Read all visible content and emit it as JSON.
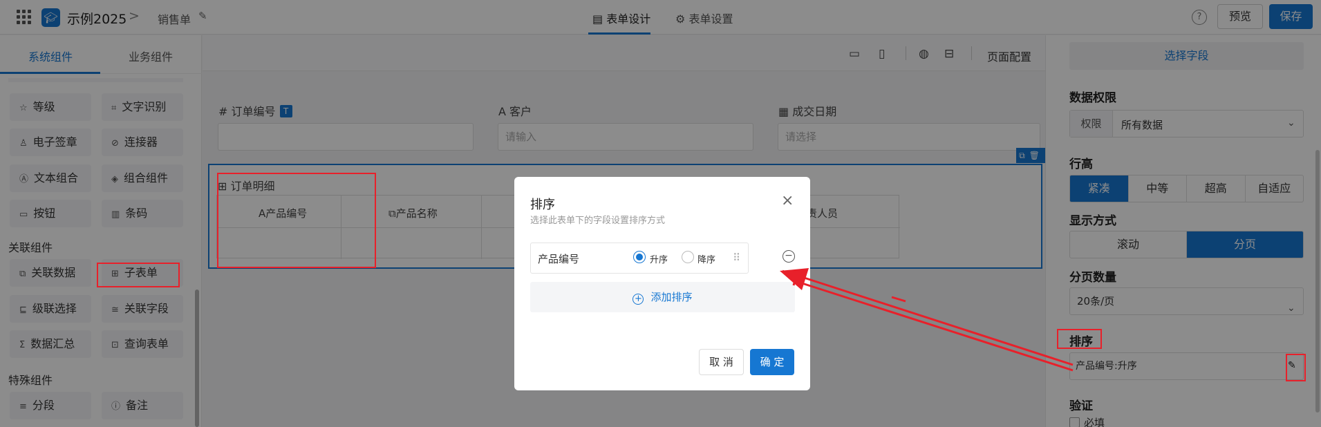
{
  "topbar": {
    "app_name": "示例2025",
    "separator": ">",
    "form_name": "销售单",
    "tabs": [
      {
        "label": "表单设计",
        "icon": "document-icon"
      },
      {
        "label": "表单设置",
        "icon": "gear-icon"
      }
    ],
    "help": "?",
    "preview_label": "预览",
    "save_label": "保存"
  },
  "left_panel": {
    "tabs": [
      "系统组件",
      "业务组件"
    ],
    "components_top": [
      {
        "label": "等级",
        "icon": "☆"
      },
      {
        "label": "文字识别",
        "icon": "⌗"
      },
      {
        "label": "电子签章",
        "icon": "♙"
      },
      {
        "label": "连接器",
        "icon": "⊘"
      },
      {
        "label": "文本组合",
        "icon": "Ⓐ"
      },
      {
        "label": "组合组件",
        "icon": "◈"
      },
      {
        "label": "按钮",
        "icon": "▭"
      },
      {
        "label": "条码",
        "icon": "▥"
      }
    ],
    "group_related": "关联组件",
    "components_related": [
      {
        "label": "关联数据",
        "icon": "⧉"
      },
      {
        "label": "子表单",
        "icon": "⊞"
      },
      {
        "label": "级联选择",
        "icon": "⊑"
      },
      {
        "label": "关联字段",
        "icon": "≅"
      },
      {
        "label": "数据汇总",
        "icon": "Σ"
      },
      {
        "label": "查询表单",
        "icon": "⊡"
      }
    ],
    "group_special": "特殊组件",
    "components_special": [
      {
        "label": "分段",
        "icon": "≡"
      },
      {
        "label": "备注",
        "icon": "ⓘ"
      }
    ]
  },
  "canvas": {
    "page_config": "页面配置",
    "fields": [
      {
        "icon": "#",
        "label": "订单编号",
        "placeholder": "",
        "badge": "T"
      },
      {
        "icon": "A",
        "label": "客户",
        "placeholder": "请输入"
      },
      {
        "icon": "▦",
        "label": "成交日期",
        "placeholder": "请选择"
      }
    ],
    "subform": {
      "title": "订单明细",
      "columns": [
        {
          "icon": "A",
          "label": "产品编号"
        },
        {
          "icon": "",
          "label": ""
        },
        {
          "icon": "⧉",
          "label": "产品名称"
        },
        {
          "icon": "",
          "label": "责人员"
        }
      ]
    }
  },
  "right_panel": {
    "select_field": "选择字段",
    "data_permission": {
      "title": "数据权限",
      "label": "权限",
      "value": "所有数据"
    },
    "row_height": {
      "title": "行高",
      "options": [
        "紧凑",
        "中等",
        "超高",
        "自适应"
      ],
      "selected": "紧凑"
    },
    "display_mode": {
      "title": "显示方式",
      "options": [
        "滚动",
        "分页"
      ],
      "selected": "分页"
    },
    "page_count": {
      "title": "分页数量",
      "value": "20条/页"
    },
    "sort": {
      "title": "排序",
      "value": "产品编号:升序"
    },
    "validation": {
      "title": "验证",
      "required_label": "必填"
    }
  },
  "modal": {
    "title": "排序",
    "subtitle": "选择此表单下的字段设置排序方式",
    "close": "×",
    "row": {
      "field": "产品编号",
      "asc": "升序",
      "desc": "降序",
      "selected": "升序"
    },
    "add_sort": "添加排序",
    "cancel": "取 消",
    "ok": "确 定"
  },
  "colors": {
    "accent": "#1677d2",
    "annotation": "#e8202a"
  }
}
